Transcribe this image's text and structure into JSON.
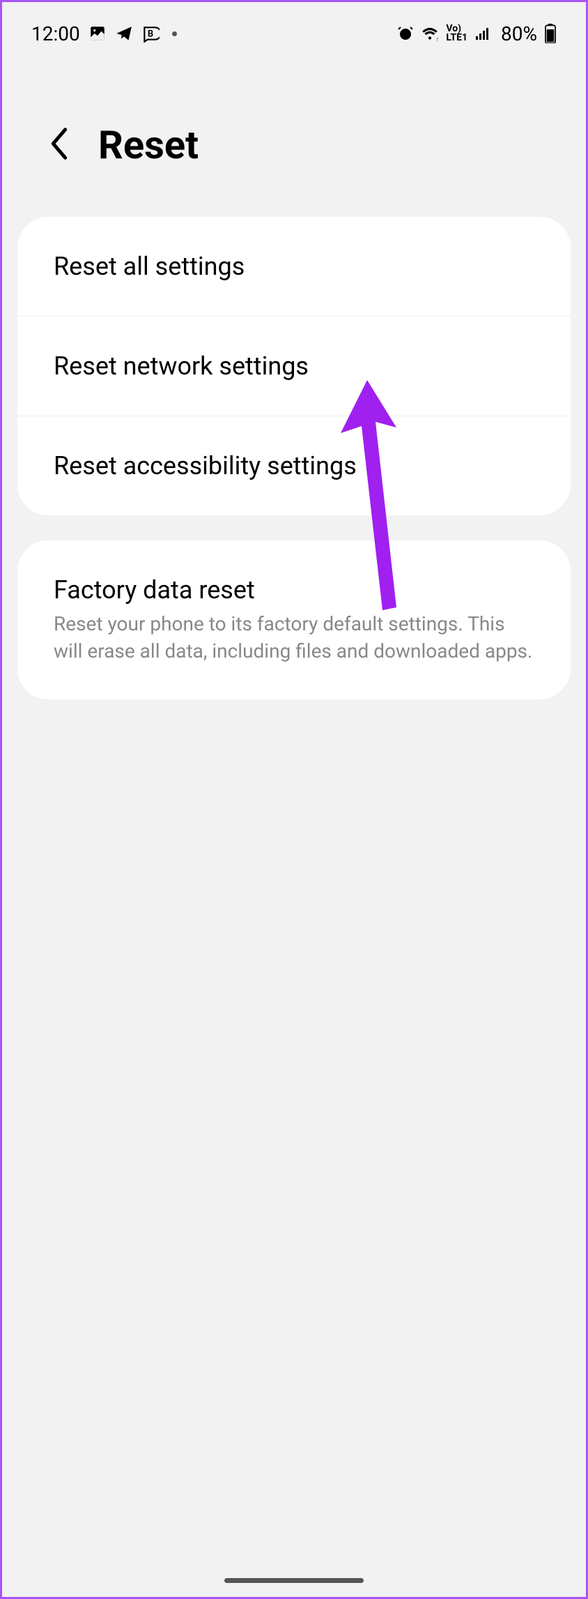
{
  "statusBar": {
    "time": "12:00",
    "batteryPercent": "80%"
  },
  "header": {
    "title": "Reset"
  },
  "group1": {
    "items": [
      {
        "title": "Reset all settings"
      },
      {
        "title": "Reset network settings"
      },
      {
        "title": "Reset accessibility settings"
      }
    ]
  },
  "group2": {
    "items": [
      {
        "title": "Factory data reset",
        "subtitle": "Reset your phone to its factory default settings. This will erase all data, including files and downloaded apps."
      }
    ]
  }
}
